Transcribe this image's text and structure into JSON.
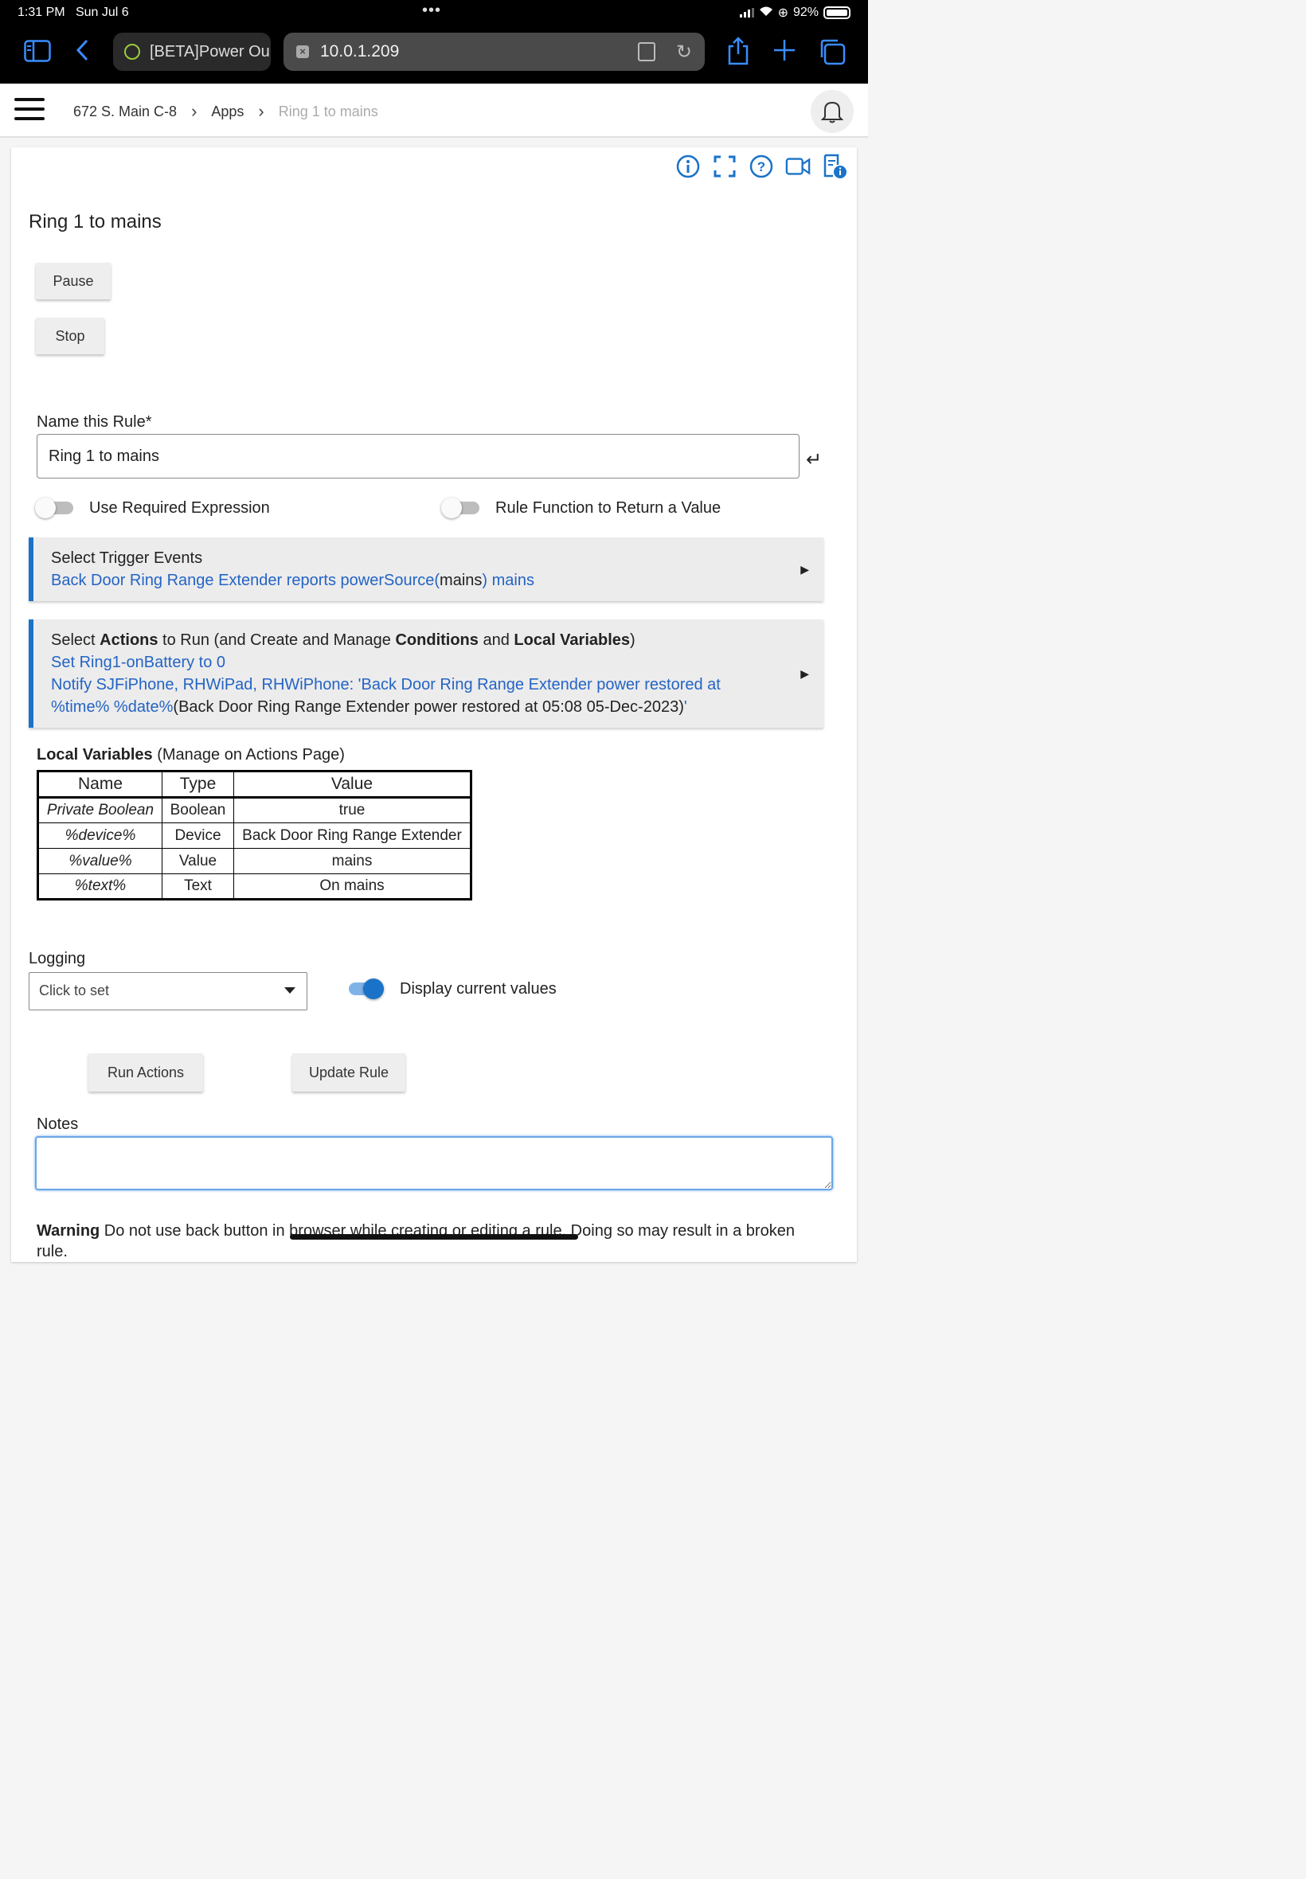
{
  "status_bar": {
    "time": "1:31 PM",
    "date": "Sun Jul 6",
    "battery": "92%"
  },
  "browser": {
    "tab1_title": "[BETA]Power Ou",
    "url": "10.0.1.209"
  },
  "breadcrumb": {
    "hub": "672 S. Main C-8",
    "apps": "Apps",
    "current": "Ring 1 to mains"
  },
  "page": {
    "title": "Ring 1 to mains",
    "pause_label": "Pause",
    "stop_label": "Stop"
  },
  "rule_name": {
    "label": "Name this Rule*",
    "value": "Ring 1 to mains"
  },
  "toggles": {
    "required_expression": {
      "label": "Use Required Expression",
      "on": false
    },
    "rule_function": {
      "label": "Rule Function to Return a Value",
      "on": false
    },
    "display_current": {
      "label": "Display current values",
      "on": true
    }
  },
  "triggers": {
    "title": "Select Trigger Events",
    "line_blue1": "Back Door Ring Range Extender reports powerSource(",
    "line_black": "mains",
    "line_blue2": ") mains"
  },
  "actions": {
    "t1": "Select ",
    "t2": "Actions",
    "t3": " to Run (and Create and Manage ",
    "t4": "Conditions",
    "t5": " and ",
    "t6": "Local Variables",
    "t7": ")",
    "line1": "Set Ring1-onBattery to 0",
    "line2": "Notify SJFiPhone, RHWiPad, RHWiPhone: 'Back Door Ring Range Extender power restored at",
    "line3_blue": "%time% %date%",
    "line3_black": "(Back Door Ring Range Extender power restored at 05:08 05-Dec-2023)",
    "line3_end": "'"
  },
  "local_variables": {
    "title_bold": "Local Variables",
    "title_rest": " (Manage on Actions Page)",
    "headers": [
      "Name",
      "Type",
      "Value"
    ],
    "rows": [
      [
        "Private Boolean",
        "Boolean",
        "true"
      ],
      [
        "%device%",
        "Device",
        "Back Door Ring Range Extender"
      ],
      [
        "%value%",
        "Value",
        "mains"
      ],
      [
        "%text%",
        "Text",
        "On mains"
      ]
    ]
  },
  "logging": {
    "label": "Logging",
    "placeholder": "Click to set"
  },
  "buttons": {
    "run_actions": "Run Actions",
    "update_rule": "Update Rule"
  },
  "notes": {
    "label": "Notes"
  },
  "warning": {
    "bold": "Warning",
    "text": " Do not use back button in browser while creating or editing a rule. Doing so may result in a broken rule."
  },
  "colors": {
    "accent": "#1a73c8",
    "link": "#2464c4"
  }
}
